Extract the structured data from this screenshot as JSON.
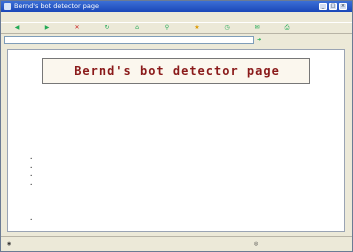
{
  "window": {
    "title": "Bernd's bot detector page"
  },
  "page": {
    "heading": "Bernd's bot detector page",
    "subheading": "",
    "intro": "",
    "section1_title": "",
    "section1_items": [
      "",
      "",
      "",
      ""
    ],
    "section2_title": "",
    "section2_items": [
      ""
    ]
  }
}
